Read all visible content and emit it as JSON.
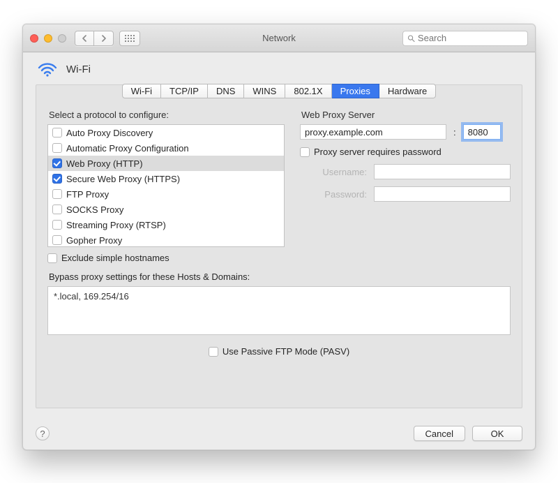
{
  "window": {
    "title": "Network"
  },
  "toolbar": {
    "search_placeholder": "Search"
  },
  "header": {
    "label": "Wi-Fi"
  },
  "tabs": [
    {
      "label": "Wi-Fi",
      "active": false
    },
    {
      "label": "TCP/IP",
      "active": false
    },
    {
      "label": "DNS",
      "active": false
    },
    {
      "label": "WINS",
      "active": false
    },
    {
      "label": "802.1X",
      "active": false
    },
    {
      "label": "Proxies",
      "active": true
    },
    {
      "label": "Hardware",
      "active": false
    }
  ],
  "left": {
    "label": "Select a protocol to configure:",
    "protocols": [
      {
        "label": "Auto Proxy Discovery",
        "checked": false,
        "selected": false
      },
      {
        "label": "Automatic Proxy Configuration",
        "checked": false,
        "selected": false
      },
      {
        "label": "Web Proxy (HTTP)",
        "checked": true,
        "selected": true
      },
      {
        "label": "Secure Web Proxy (HTTPS)",
        "checked": true,
        "selected": false
      },
      {
        "label": "FTP Proxy",
        "checked": false,
        "selected": false
      },
      {
        "label": "SOCKS Proxy",
        "checked": false,
        "selected": false
      },
      {
        "label": "Streaming Proxy (RTSP)",
        "checked": false,
        "selected": false
      },
      {
        "label": "Gopher Proxy",
        "checked": false,
        "selected": false
      }
    ],
    "exclude_label": "Exclude simple hostnames",
    "exclude_checked": false
  },
  "right": {
    "label": "Web Proxy Server",
    "server": "proxy.example.com",
    "port": "8080",
    "password_required_label": "Proxy server requires password",
    "password_required": false,
    "username_label": "Username:",
    "username": "",
    "password_label": "Password:",
    "password": ""
  },
  "bypass": {
    "label": "Bypass proxy settings for these Hosts & Domains:",
    "value": "*.local, 169.254/16"
  },
  "pasv": {
    "label": "Use Passive FTP Mode (PASV)",
    "checked": false
  },
  "footer": {
    "cancel": "Cancel",
    "ok": "OK"
  }
}
